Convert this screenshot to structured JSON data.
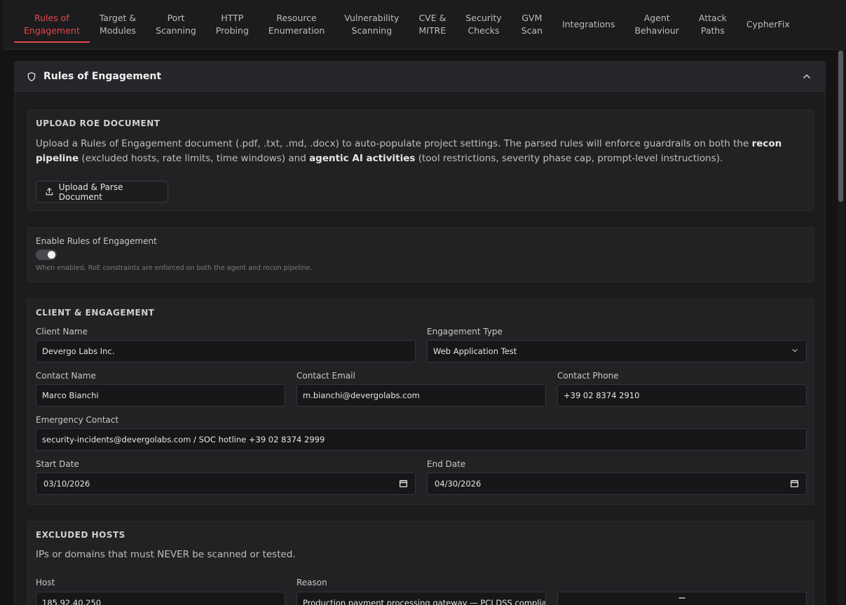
{
  "tabs": [
    {
      "label": "Rules of\nEngagement",
      "active": true
    },
    {
      "label": "Target &\nModules"
    },
    {
      "label": "Port\nScanning"
    },
    {
      "label": "HTTP\nProbing"
    },
    {
      "label": "Resource\nEnumeration"
    },
    {
      "label": "Vulnerability\nScanning"
    },
    {
      "label": "CVE &\nMITRE"
    },
    {
      "label": "Security\nChecks"
    },
    {
      "label": "GVM\nScan"
    },
    {
      "label": "Integrations"
    },
    {
      "label": "Agent\nBehaviour"
    },
    {
      "label": "Attack\nPaths"
    },
    {
      "label": "CypherFix"
    }
  ],
  "panel": {
    "title": "Rules of Engagement"
  },
  "upload": {
    "heading": "UPLOAD ROE DOCUMENT",
    "desc_1": "Upload a Rules of Engagement document (.pdf, .txt, .md, .docx) to auto-populate project settings. The parsed rules will enforce guardrails on both the ",
    "desc_bold_1": "recon pipeline",
    "desc_2": " (excluded hosts, rate limits, time windows) and ",
    "desc_bold_2": "agentic AI activities",
    "desc_3": " (tool restrictions, severity phase cap, prompt-level instructions).",
    "button_label": "Upload & Parse Document"
  },
  "enable": {
    "label": "Enable Rules of Engagement",
    "enabled": true,
    "hint": "When enabled, RoE constraints are enforced on both the agent and recon pipeline."
  },
  "client": {
    "heading": "CLIENT & ENGAGEMENT",
    "client_name_label": "Client Name",
    "client_name": "Devergo Labs Inc.",
    "engagement_type_label": "Engagement Type",
    "engagement_type": "Web Application Test",
    "contact_name_label": "Contact Name",
    "contact_name": "Marco Bianchi",
    "contact_email_label": "Contact Email",
    "contact_email": "m.bianchi@devergolabs.com",
    "contact_phone_label": "Contact Phone",
    "contact_phone": "+39 02 8374 2910",
    "emergency_label": "Emergency Contact",
    "emergency": "security-incidents@devergolabs.com / SOC hotline +39 02 8374 2999",
    "start_label": "Start Date",
    "start_date": "03/10/2026",
    "end_label": "End Date",
    "end_date": "04/30/2026"
  },
  "excluded": {
    "heading": "EXCLUDED HOSTS",
    "desc": "IPs or domains that must NEVER be scanned or tested.",
    "host_label": "Host",
    "reason_label": "Reason",
    "rows": [
      {
        "host": "185.92.40.250",
        "reason": "Production payment processing gateway — PCI DSS compliance"
      }
    ]
  },
  "colors": {
    "accent": "#e5484d",
    "background": "#141415",
    "panel": "#1c1c1e"
  }
}
